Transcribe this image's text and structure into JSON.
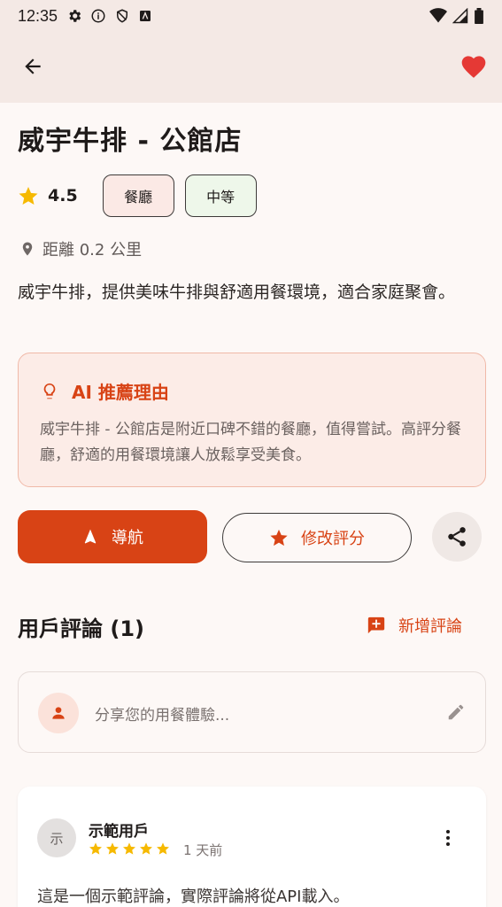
{
  "status_bar": {
    "time": "12:35"
  },
  "restaurant": {
    "name": "威宇牛排 - 公館店",
    "rating": "4.5",
    "category": "餐廳",
    "price_level": "中等",
    "distance": "距離 0.2 公里",
    "description": "威宇牛排，提供美味牛排與舒適用餐環境，適合家庭聚會。"
  },
  "ai": {
    "title": "AI 推薦理由",
    "body": "威宇牛排 - 公館店是附近口碑不錯的餐廳，值得嘗試。高評分餐廳，舒適的用餐環境讓人放鬆享受美食。"
  },
  "actions": {
    "navigate": "導航",
    "edit_rating": "修改評分"
  },
  "reviews": {
    "header": "用戶評論 (1)",
    "add_label": "新增評論",
    "composer_placeholder": "分享您的用餐體驗...",
    "items": [
      {
        "avatar_text": "示",
        "author": "示範用戶",
        "stars": 5,
        "time": "1 天前",
        "text": "這是一個示範評論，實際評論將從API載入。"
      }
    ]
  },
  "colors": {
    "accent": "#d84315",
    "star": "#f6b900",
    "heart": "#e53935"
  }
}
